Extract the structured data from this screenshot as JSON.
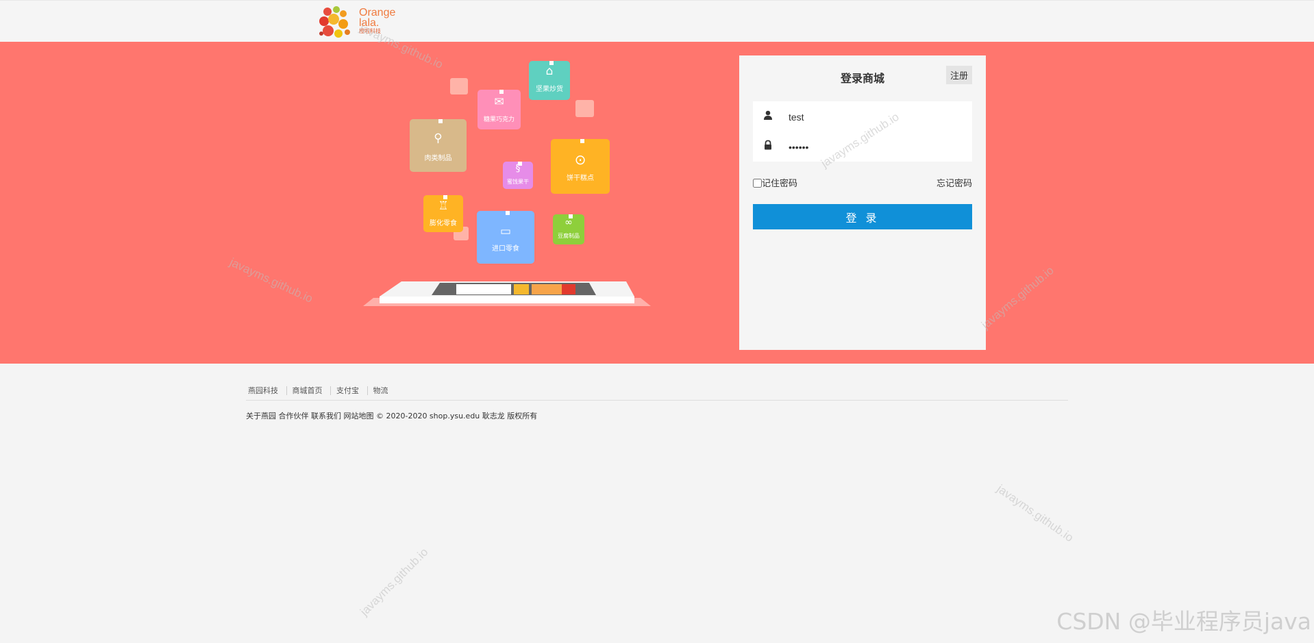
{
  "brand": {
    "logo_text": "Orange\nlala.",
    "logo_sub": "橙啦科技"
  },
  "illustration": {
    "bubbles": [
      {
        "label": "坚果炒货",
        "icon": "nut-icon",
        "color": "#5fd0c0"
      },
      {
        "label": "糖果巧克力",
        "icon": "candy-icon",
        "color": "#ff8fb8"
      },
      {
        "label": "肉类制品",
        "icon": "drumstick-icon",
        "color": "#d8b98a"
      },
      {
        "label": "蜜饯果干",
        "icon": "fruit-icon",
        "color": "#e68ce8"
      },
      {
        "label": "饼干糕点",
        "icon": "cookie-icon",
        "color": "#ffb324"
      },
      {
        "label": "膨化零食",
        "icon": "snack-icon",
        "color": "#ffb324"
      },
      {
        "label": "进口零食",
        "icon": "plane-icon",
        "color": "#7eb6ff"
      },
      {
        "label": "豆腐制品",
        "icon": "tofu-icon",
        "color": "#8ecf3b"
      }
    ]
  },
  "login": {
    "title": "登录商城",
    "register_label": "注册",
    "username_value": "test",
    "password_value": "123456",
    "remember_label": "记住密码",
    "forgot_label": "忘记密码",
    "submit_label": "登 录"
  },
  "footer": {
    "links": [
      "燕园科技",
      "商城首页",
      "支付宝",
      "物流"
    ],
    "copyright": "关于燕园 合作伙伴 联系我们 网站地图 © 2020-2020 shop.ysu.edu 耿志龙 版权所有"
  },
  "watermark": {
    "text": "javayms.github.io",
    "csdn": "CSDN @毕业程序员java"
  },
  "colors": {
    "banner": "#ff766e",
    "primary": "#1090d8",
    "page_bg": "#f4f4f4"
  }
}
